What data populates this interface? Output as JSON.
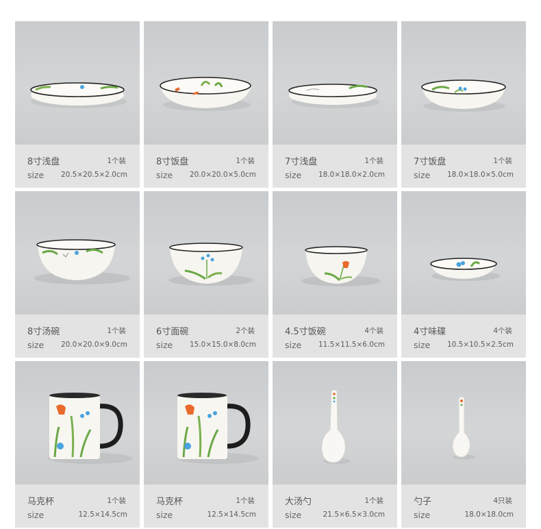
{
  "products": [
    {
      "name": "8寸浅盘",
      "qty": "1个装",
      "size_label": "size",
      "size_value": "20.5×20.5×2.0cm",
      "icon": "shallow-plate-icon"
    },
    {
      "name": "8寸饭盘",
      "qty": "1个装",
      "size_label": "size",
      "size_value": "20.0×20.0×5.0cm",
      "icon": "deep-plate-icon"
    },
    {
      "name": "7寸浅盘",
      "qty": "1个装",
      "size_label": "size",
      "size_value": "18.0×18.0×2.0cm",
      "icon": "shallow-plate-icon"
    },
    {
      "name": "7寸饭盘",
      "qty": "1个装",
      "size_label": "size",
      "size_value": "18.0×18.0×5.0cm",
      "icon": "deep-plate-icon"
    },
    {
      "name": "8寸汤碗",
      "qty": "1个装",
      "size_label": "size",
      "size_value": "20.0×20.0×9.0cm",
      "icon": "soup-bowl-icon"
    },
    {
      "name": "6寸面碗",
      "qty": "2个装",
      "size_label": "size",
      "size_value": "15.0×15.0×8.0cm",
      "icon": "noodle-bowl-icon"
    },
    {
      "name": "4.5寸饭碗",
      "qty": "4个装",
      "size_label": "size",
      "size_value": "11.5×11.5×6.0cm",
      "icon": "rice-bowl-icon"
    },
    {
      "name": "4寸味碟",
      "qty": "4个装",
      "size_label": "size",
      "size_value": "10.5×10.5×2.5cm",
      "icon": "sauce-dish-icon"
    },
    {
      "name": "马克杯",
      "qty": "1个装",
      "size_label": "size",
      "size_value": "12.5×14.5cm",
      "icon": "mug-icon"
    },
    {
      "name": "马克杯",
      "qty": "1个装",
      "size_label": "size",
      "size_value": "12.5×14.5cm",
      "icon": "mug-icon"
    },
    {
      "name": "大汤勺",
      "qty": "1个装",
      "size_label": "size",
      "size_value": "21.5×6.5×3.0cm",
      "icon": "ladle-icon"
    },
    {
      "name": "勺子",
      "qty": "4只装",
      "size_label": "size",
      "size_value": "18.0×18.0cm",
      "icon": "spoon-icon"
    }
  ]
}
